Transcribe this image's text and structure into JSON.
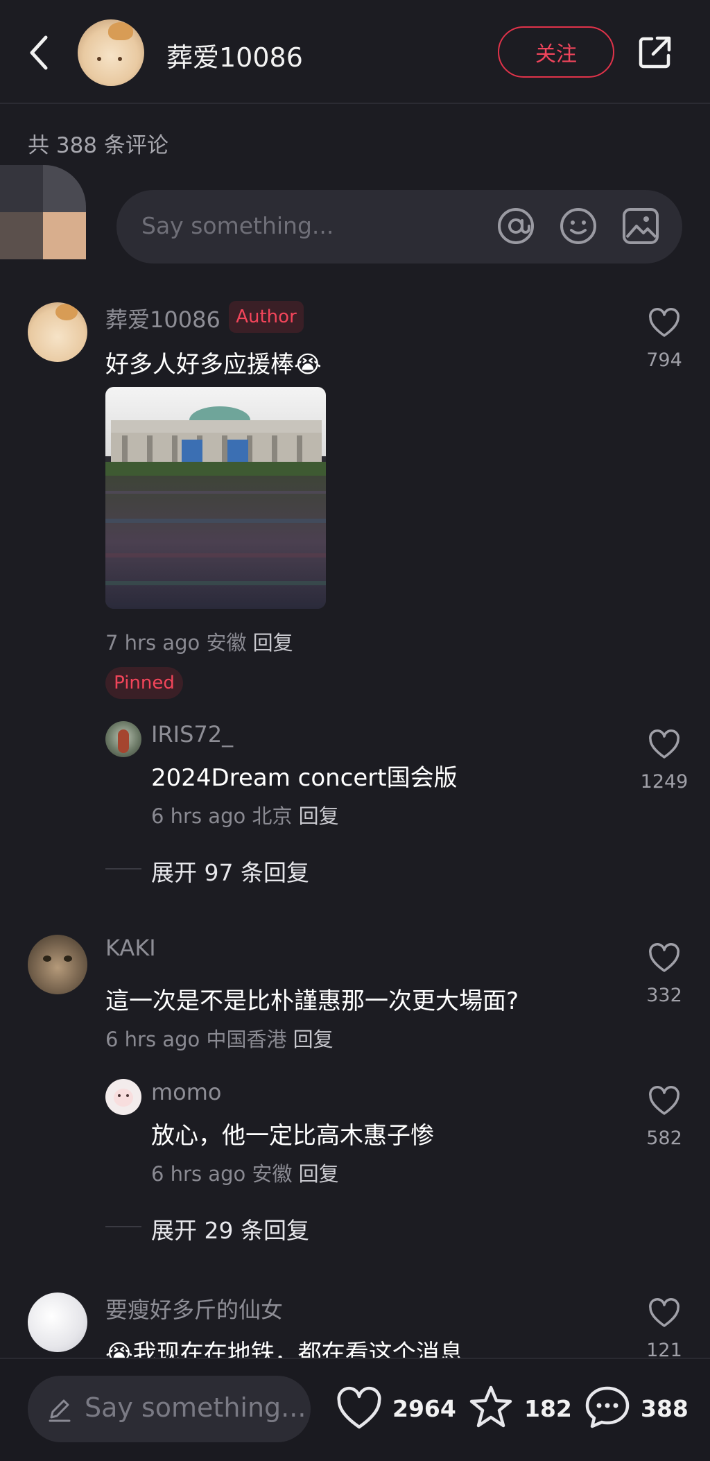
{
  "header": {
    "username": "葬爱10086",
    "follow_label": "关注"
  },
  "comment_count_text": "共 388 条评论",
  "composer": {
    "placeholder": "Say something..."
  },
  "comments": [
    {
      "username": "葬爱10086",
      "badge": "Author",
      "text": "好多人好多应援棒",
      "emoji": "😭",
      "likes": "794",
      "time": "7 hrs ago 安徽",
      "reply_label": "回复",
      "pinned_label": "Pinned",
      "replies": [
        {
          "username": "IRIS72_",
          "text": "2024Dream concert国会版",
          "time": "6 hrs ago 北京",
          "reply_label": "回复",
          "likes": "1249"
        }
      ],
      "expand_label": "展开 97 条回复"
    },
    {
      "username": "KAKI",
      "text": "這一次是不是比朴謹惠那一次更大場面?",
      "likes": "332",
      "time": "6 hrs ago 中国香港",
      "reply_label": "回复",
      "replies": [
        {
          "username": "momo",
          "text": "放心，他一定比高木惠子惨",
          "time": "6 hrs ago 安徽",
          "reply_label": "回复",
          "likes": "582"
        }
      ],
      "expand_label": "展开 29 条回复"
    },
    {
      "username": "要瘦好多斤的仙女",
      "emoji": "😭",
      "text": "我现在在地铁，都在看这个消息",
      "likes": "121"
    }
  ],
  "bottom_bar": {
    "placeholder": "Say something...",
    "likes": "2964",
    "favorites": "182",
    "comments": "388"
  },
  "colors": {
    "background": "#1c1c22",
    "accent": "#f0455c",
    "muted_text": "#8a8a92"
  },
  "icons": [
    "back-icon",
    "share-icon",
    "at-icon",
    "emoji-icon",
    "image-icon",
    "heart-icon",
    "star-icon",
    "comment-bubble-icon",
    "pencil-icon"
  ]
}
